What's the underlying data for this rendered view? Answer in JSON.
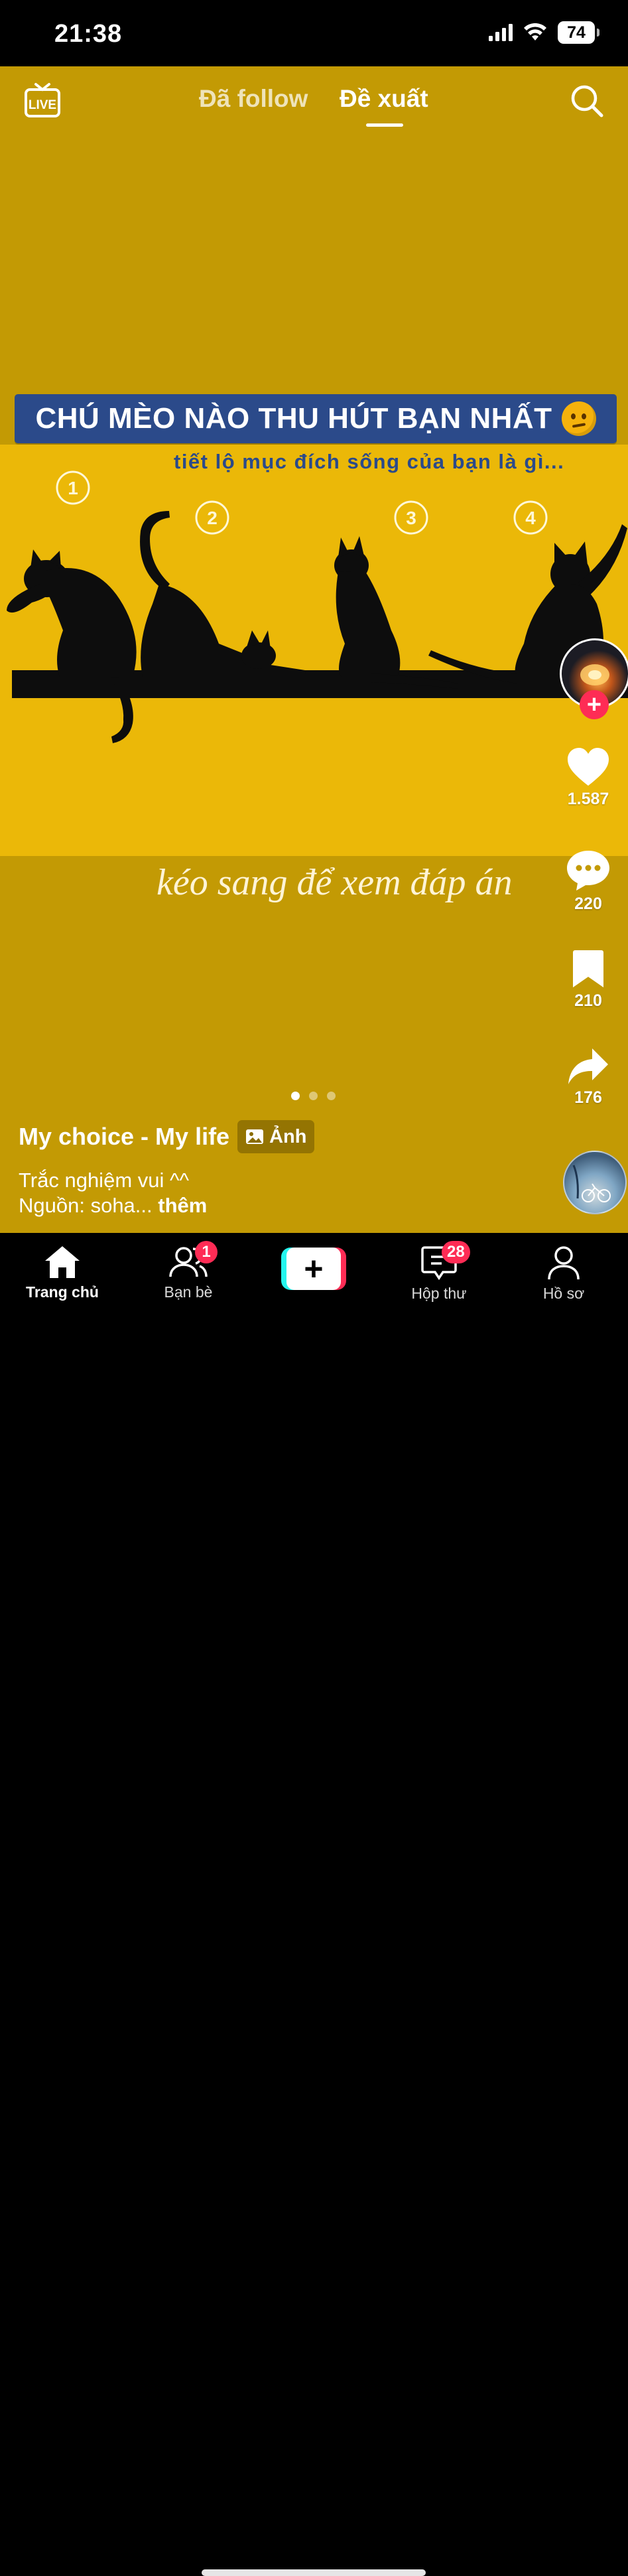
{
  "status_bar": {
    "time": "21:38",
    "battery": "74",
    "icons": [
      "signal-icon",
      "wifi-icon",
      "battery-icon"
    ]
  },
  "top_nav": {
    "live_label": "LIVE",
    "tabs": [
      {
        "label": "Đã follow",
        "active": false
      },
      {
        "label": "Đề xuất",
        "active": true
      }
    ]
  },
  "post": {
    "banner_title": "CHÚ MÈO NÀO THU HÚT BẠN NHẤT",
    "subtitle": "tiết lộ mục đích sống của bạn là gì...",
    "cat_numbers": [
      "1",
      "2",
      "3",
      "4"
    ],
    "swipe_hint": "kéo sang để xem đáp án",
    "slides": {
      "current": 1,
      "total": 3
    },
    "author": "My choice - My life",
    "media_badge": "Ảnh",
    "caption_lines": [
      "Trắc nghiệm vui ^^",
      "Nguồn: soha..."
    ],
    "more_label": " thêm"
  },
  "actions": {
    "likes": "1.587",
    "comments": "220",
    "saves": "210",
    "shares": "176"
  },
  "tab_bar": {
    "home": "Trang chủ",
    "friends": "Bạn bè",
    "friends_badge": "1",
    "create": "+",
    "inbox": "Hộp thư",
    "inbox_badge": "28",
    "profile": "Hồ sơ"
  },
  "colors": {
    "background": "#c39a04",
    "image_band": "#ebb808",
    "banner": "#2b4a8a",
    "accent": "#fe2c55",
    "cyan": "#25f4ee"
  }
}
